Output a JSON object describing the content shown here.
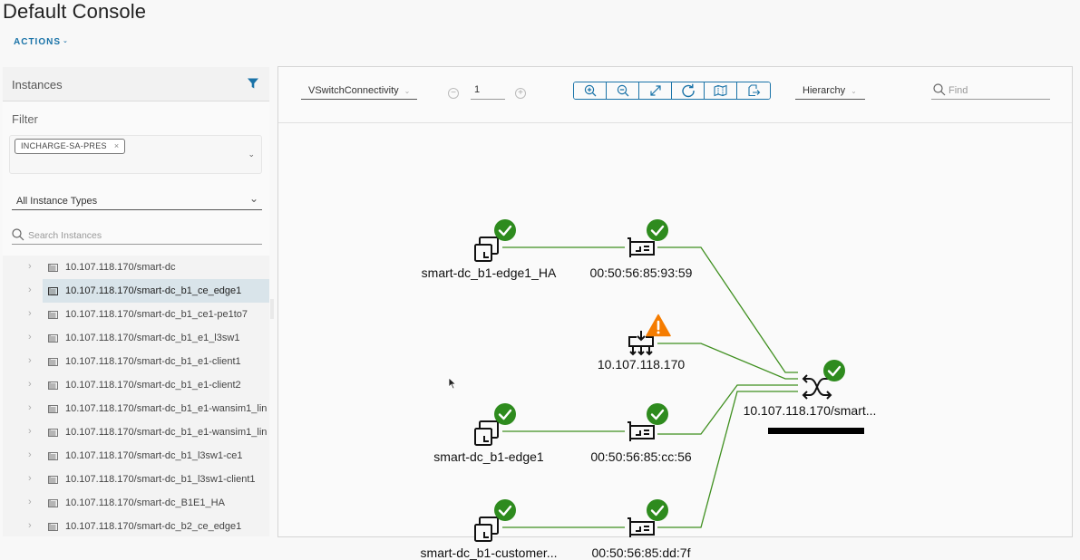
{
  "header": {
    "title": "Default Console",
    "actions_label": "ACTIONS"
  },
  "left_panel": {
    "instances_title": "Instances",
    "filter_label": "Filter",
    "filter_chip": "INCHARGE-SA-PRES",
    "instance_type": "All Instance Types",
    "search_placeholder": "Search Instances",
    "tree_items": [
      {
        "label": "10.107.118.170/smart-dc",
        "selected": false
      },
      {
        "label": "10.107.118.170/smart-dc_b1_ce_edge1",
        "selected": true
      },
      {
        "label": "10.107.118.170/smart-dc_b1_ce1-pe1to7",
        "selected": false
      },
      {
        "label": "10.107.118.170/smart-dc_b1_e1_l3sw1",
        "selected": false
      },
      {
        "label": "10.107.118.170/smart-dc_b1_e1-client1",
        "selected": false
      },
      {
        "label": "10.107.118.170/smart-dc_b1_e1-client2",
        "selected": false
      },
      {
        "label": "10.107.118.170/smart-dc_b1_e1-wansim1_lin",
        "selected": false
      },
      {
        "label": "10.107.118.170/smart-dc_b1_e1-wansim1_lin",
        "selected": false
      },
      {
        "label": "10.107.118.170/smart-dc_b1_l3sw1-ce1",
        "selected": false
      },
      {
        "label": "10.107.118.170/smart-dc_b1_l3sw1-client1",
        "selected": false
      },
      {
        "label": "10.107.118.170/smart-dc_B1E1_HA",
        "selected": false
      },
      {
        "label": "10.107.118.170/smart-dc_b2_ce_edge1",
        "selected": false
      }
    ]
  },
  "toolbar": {
    "view": "VSwitchConnectivity",
    "level": "1",
    "layout": "Hierarchy",
    "find_placeholder": "Find",
    "tools": [
      "zoom-in",
      "zoom-out",
      "fit-to-screen",
      "refresh",
      "map",
      "export"
    ]
  },
  "topology": {
    "colors": {
      "link": "#3f8f1f",
      "ok": "#2e8b1e",
      "warning": "#f57c00"
    },
    "nodes": [
      {
        "id": "vm1",
        "type": "vm",
        "label": "smart-dc_b1-edge1_HA",
        "status": "ok"
      },
      {
        "id": "nic1",
        "type": "nic",
        "label": "00:50:56:85:93:59",
        "status": "ok"
      },
      {
        "id": "host",
        "type": "host",
        "label": "10.107.118.170",
        "status": "warning"
      },
      {
        "id": "vm2",
        "type": "vm",
        "label": "smart-dc_b1-edge1",
        "status": "ok"
      },
      {
        "id": "nic2",
        "type": "nic",
        "label": "00:50:56:85:cc:56",
        "status": "ok"
      },
      {
        "id": "vm3",
        "type": "vm",
        "label": "smart-dc_b1-customer...",
        "status": "ok"
      },
      {
        "id": "nic3",
        "type": "nic",
        "label": "00:50:56:85:dd:7f",
        "status": "ok"
      },
      {
        "id": "vswitch",
        "type": "switch",
        "label": "10.107.118.170/smart...",
        "status": "ok"
      }
    ],
    "links": [
      [
        "vm1",
        "nic1"
      ],
      [
        "vm2",
        "nic2"
      ],
      [
        "vm3",
        "nic3"
      ],
      [
        "nic1",
        "vswitch"
      ],
      [
        "host",
        "vswitch"
      ],
      [
        "nic2",
        "vswitch"
      ],
      [
        "nic3",
        "vswitch"
      ]
    ]
  }
}
